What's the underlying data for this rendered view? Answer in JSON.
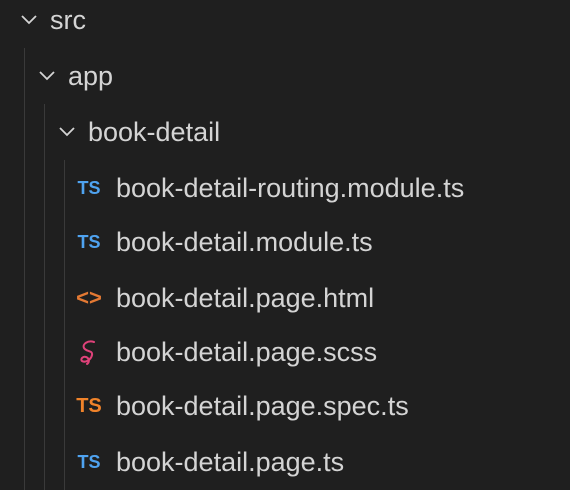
{
  "tree": {
    "folders": [
      {
        "label": "src",
        "expanded": true
      },
      {
        "label": "app",
        "expanded": true
      },
      {
        "label": "book-detail",
        "expanded": true
      }
    ],
    "files": [
      {
        "label": "book-detail-routing.module.ts",
        "icon": "TS",
        "type": "typescript"
      },
      {
        "label": "book-detail.module.ts",
        "icon": "TS",
        "type": "typescript"
      },
      {
        "label": "book-detail.page.html",
        "icon": "<>",
        "type": "html"
      },
      {
        "label": "book-detail.page.scss",
        "icon": "sass-icon",
        "type": "scss"
      },
      {
        "label": "book-detail.page.spec.ts",
        "icon": "TS",
        "type": "typescript-test"
      },
      {
        "label": "book-detail.page.ts",
        "icon": "TS",
        "type": "typescript"
      }
    ]
  },
  "colors": {
    "background": "#1f1f1f",
    "text": "#d4d4d4",
    "ts_blue": "#4fa3f0",
    "ts_spec_orange": "#f0832a",
    "html_orange": "#e37933",
    "sass_pink": "#e0427a",
    "indent_guide": "#3a3a3a"
  }
}
